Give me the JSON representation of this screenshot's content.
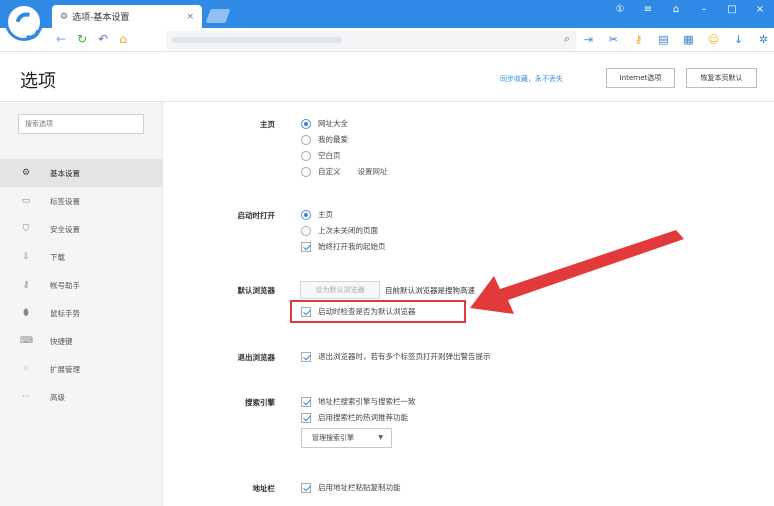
{
  "browser": {
    "tab_title": "选项-基本设置",
    "tab_close": "×",
    "window_controls": [
      "①",
      "≡",
      "⌂",
      "–",
      "□",
      "×"
    ],
    "nav": [
      {
        "icon": "back-arrow-icon",
        "glyph": "←",
        "color": "#7aa8e0"
      },
      {
        "icon": "refresh-icon",
        "glyph": "↻",
        "color": "#3cb043"
      },
      {
        "icon": "undo-icon",
        "glyph": "↶",
        "color": "#8e5fd0"
      },
      {
        "icon": "home-icon",
        "glyph": "⌂",
        "color": "#f0a020"
      }
    ],
    "tools": [
      {
        "icon": "sidebar-icon",
        "glyph": "⇥",
        "color": "#4a90e2"
      },
      {
        "icon": "scissors-icon",
        "glyph": "✂",
        "color": "#3a6fc9"
      },
      {
        "icon": "key-icon",
        "glyph": "⚷",
        "color": "#f0a020"
      },
      {
        "icon": "book-icon",
        "glyph": "▤",
        "color": "#3a84d9"
      },
      {
        "icon": "grid-icon",
        "glyph": "▦",
        "color": "#3a84d9"
      },
      {
        "icon": "smile-icon",
        "glyph": "☺",
        "color": "#f0b020"
      },
      {
        "icon": "download-icon",
        "glyph": "↓",
        "color": "#3a84d9"
      },
      {
        "icon": "settings-icon",
        "glyph": "✲",
        "color": "#3a84d9"
      }
    ]
  },
  "header": {
    "title": "选项",
    "sync_link": "同步收藏，永不丢失",
    "internet_button": "Internet选项",
    "restore_button": "恢复本页默认"
  },
  "sidebar": {
    "search_placeholder": "搜索选项",
    "items": [
      {
        "label": "基本设置",
        "icon": "gear-icon",
        "glyph": "⚙",
        "active": true
      },
      {
        "label": "标签设置",
        "icon": "tab-icon",
        "glyph": "▭",
        "active": false
      },
      {
        "label": "安全设置",
        "icon": "shield-icon",
        "glyph": "⛉",
        "active": false
      },
      {
        "label": "下载",
        "icon": "download-icon",
        "glyph": "⇩",
        "active": false
      },
      {
        "label": "帐号助手",
        "icon": "key-icon",
        "glyph": "⚷",
        "active": false
      },
      {
        "label": "鼠标手势",
        "icon": "mouse-icon",
        "glyph": "⬮",
        "active": false
      },
      {
        "label": "快捷键",
        "icon": "shortcut-icon",
        "glyph": "⌨",
        "active": false
      },
      {
        "label": "扩展管理",
        "icon": "extensions-icon",
        "glyph": "⁘",
        "active": false
      },
      {
        "label": "高级",
        "icon": "more-icon",
        "glyph": "···",
        "active": false
      }
    ]
  },
  "sections": {
    "homepage": {
      "label": "主页",
      "options": [
        "网址大全",
        "我的最爱",
        "空白页",
        "自定义"
      ],
      "selected": 0,
      "set_url": "设置网址"
    },
    "startup": {
      "label": "启动时打开",
      "options": [
        "主页",
        "上次未关闭的页面"
      ],
      "selected": 0,
      "checkbox": "始终打开我的起始页"
    },
    "default_browser": {
      "label": "默认浏览器",
      "button": "设为默认浏览器",
      "status": "目前默认浏览器是搜狗高速",
      "checkbox": "启动时检查是否为默认浏览器"
    },
    "exit": {
      "label": "退出浏览器",
      "checkbox": "退出浏览器时，若有多个标签页打开则弹出警告提示"
    },
    "search_engine": {
      "label": "搜索引擎",
      "checkbox1": "地址栏搜索引擎与搜索栏一致",
      "checkbox2": "启用搜索栏的热词推荐功能",
      "dropdown": "管理搜索引擎"
    },
    "address_bar": {
      "label": "地址栏",
      "checkbox": "启用地址栏粘贴复制功能"
    }
  },
  "annotation_color": "#e23a3a"
}
